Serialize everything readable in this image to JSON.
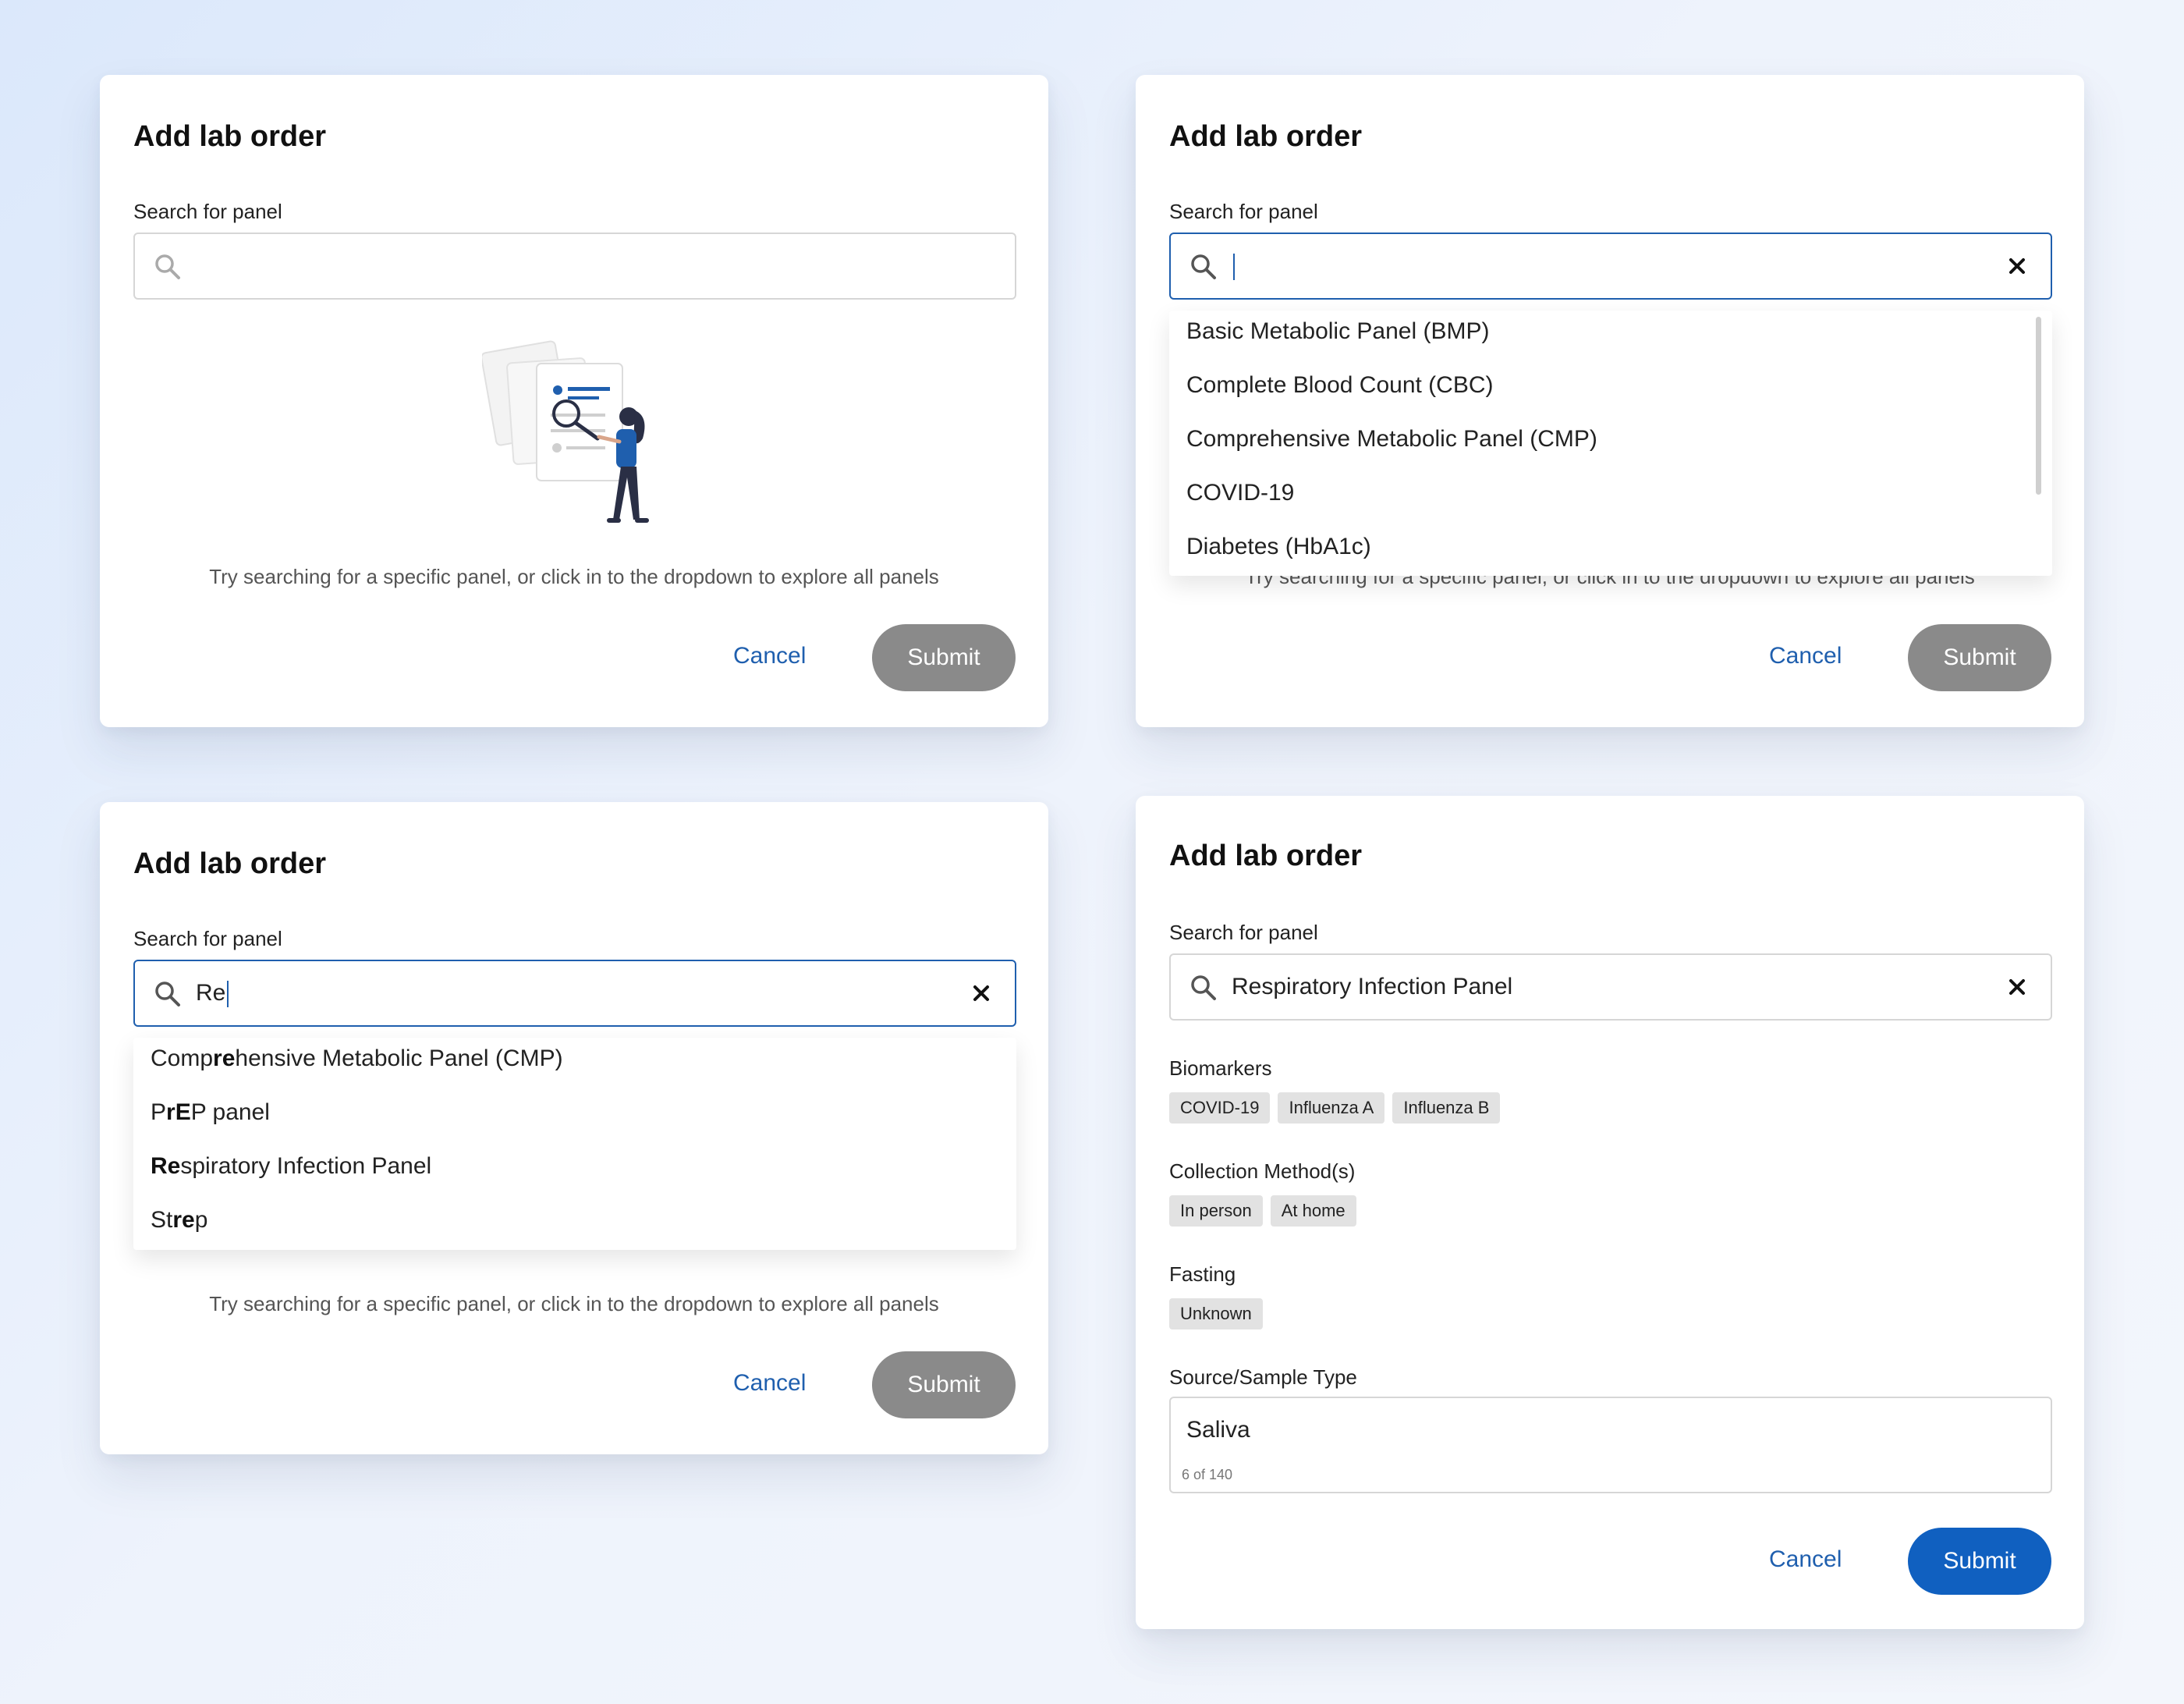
{
  "cards": [
    {
      "title": "Add lab order",
      "search_label": "Search for panel",
      "search_value": "",
      "hint": "Try searching for a specific panel, or click in to the dropdown to explore all panels",
      "cancel_label": "Cancel",
      "submit_label": "Submit"
    },
    {
      "title": "Add lab order",
      "search_label": "Search for panel",
      "search_value": "",
      "hint": "Try searching for a specific panel, or click in to the dropdown to explore all panels",
      "cancel_label": "Cancel",
      "submit_label": "Submit",
      "dropdown_items": [
        "Basic Metabolic Panel (BMP)",
        "Complete Blood Count (CBC)",
        "Comprehensive Metabolic Panel (CMP)",
        "COVID-19",
        "Diabetes (HbA1c)"
      ]
    },
    {
      "title": "Add lab order",
      "search_label": "Search for panel",
      "search_value": "Re",
      "hint": "Try searching for a specific panel, or click in to the dropdown to explore all panels",
      "cancel_label": "Cancel",
      "submit_label": "Submit",
      "dropdown_items": [
        {
          "pre": "Comp",
          "match": "re",
          "post": "hensive Metabolic Panel (CMP)"
        },
        {
          "pre": "P",
          "match": "rE",
          "post": "P panel"
        },
        {
          "pre": "",
          "match": "Re",
          "post": "spiratory Infection Panel"
        },
        {
          "pre": "St",
          "match": "re",
          "post": "p"
        }
      ]
    },
    {
      "title": "Add lab order",
      "search_label": "Search for panel",
      "search_value": "Respiratory Infection Panel",
      "biomarkers_label": "Biomarkers",
      "biomarkers": [
        "COVID-19",
        "Influenza A",
        "Influenza B"
      ],
      "collection_label": "Collection Method(s)",
      "collection": [
        "In person",
        "At home"
      ],
      "fasting_label": "Fasting",
      "fasting": [
        "Unknown"
      ],
      "source_label": "Source/Sample Type",
      "source_value": "Saliva",
      "source_counter": "6 of 140",
      "cancel_label": "Cancel",
      "submit_label": "Submit"
    }
  ],
  "icons": {
    "search": "search-icon",
    "clear": "close-icon"
  },
  "colors": {
    "accent": "#1f5fae",
    "submit_disabled": "#8a8a8a",
    "submit_enabled": "#1060c0"
  }
}
